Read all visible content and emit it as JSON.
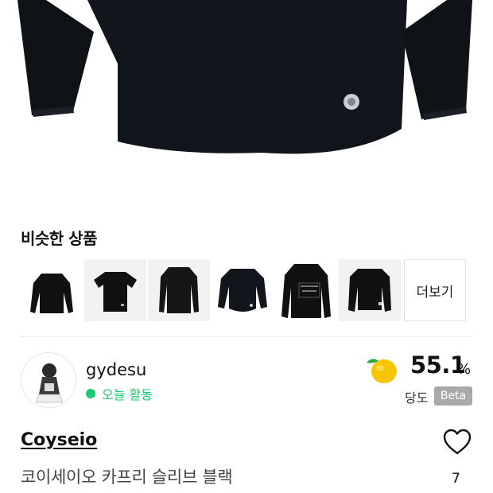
{
  "similar": {
    "title": "비슷한 상품",
    "items": [
      "long-sleeve-crop-black",
      "tshirt-black",
      "long-sleeve-black",
      "long-sleeve-curve-black",
      "hoodie-black-print",
      "long-sleeve-logo-black"
    ],
    "more_label": "더보기"
  },
  "seller": {
    "name": "gydesu",
    "status": "오늘 활동",
    "status_color": "#1ec873"
  },
  "sweetness": {
    "value": "55.1",
    "unit": "%",
    "label": "당도",
    "badge": "Beta"
  },
  "product": {
    "brand": "Coyseio",
    "name": "코이세이오 카프리 슬리브 블랙",
    "likes": "7"
  },
  "icons": {
    "apple": "apple-icon",
    "heart": "heart-icon"
  }
}
